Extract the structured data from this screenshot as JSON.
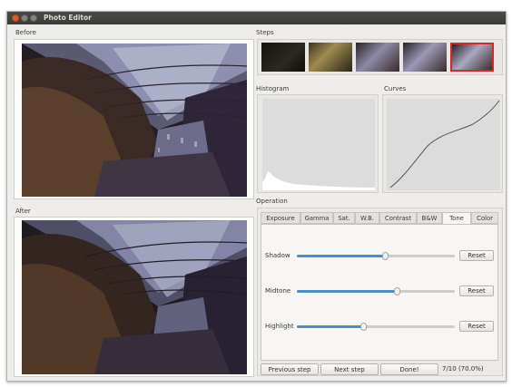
{
  "window": {
    "title": "Photo Editor"
  },
  "sections": {
    "before": "Before",
    "after": "After",
    "steps": "Steps",
    "histogram": "Histogram",
    "curves": "Curves",
    "operation": "Operation"
  },
  "tabs": [
    "Exposure",
    "Gamma",
    "Sat.",
    "W.B.",
    "Contrast",
    "B&W",
    "Tone",
    "Color"
  ],
  "active_tab": "Tone",
  "sliders": [
    {
      "label": "Shadow",
      "value": 0.56,
      "reset": "Reset"
    },
    {
      "label": "Midtone",
      "value": 0.63,
      "reset": "Reset"
    },
    {
      "label": "Highlight",
      "value": 0.42,
      "reset": "Reset"
    }
  ],
  "buttons": {
    "prev": "Previous step",
    "next": "Next step",
    "done": "Done!"
  },
  "status": "7/10 (70.0%)",
  "colors": {
    "accent": "#4a90c8",
    "selection": "#d8262d",
    "titlebar": "#3b3b38",
    "close": "#e4582e"
  },
  "steps": {
    "count": 5,
    "selected_index": 4
  }
}
